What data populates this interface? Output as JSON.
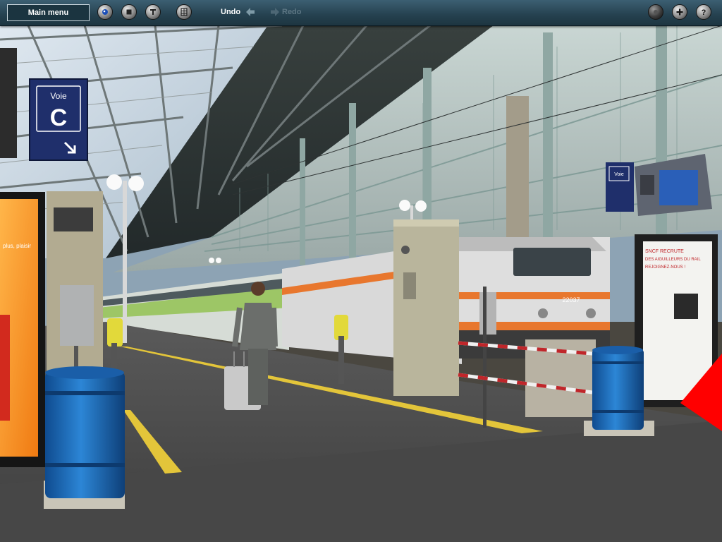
{
  "toolbar": {
    "main_menu_label": "Main menu",
    "undo_label": "Undo",
    "redo_label": "Redo"
  },
  "scene": {
    "platform_sign": {
      "top_text": "Voie",
      "letter": "C"
    },
    "small_sign": {
      "top_text": "Voie"
    },
    "ad_panel_right": {
      "line1": "SNCF RECRUTE",
      "line2": "DES AIGUILLEURS DU RAIL",
      "line3": "REJOIGNEZ-NOUS !"
    },
    "ad_panel_left": {
      "text": "plus, plaisir"
    },
    "locomotive_number": "22037"
  },
  "colors": {
    "toolbar": "#25414f",
    "bin_blue": "#1f6fc0",
    "sign_blue": "#1f2f6b",
    "loco_orange": "#e8772e"
  }
}
